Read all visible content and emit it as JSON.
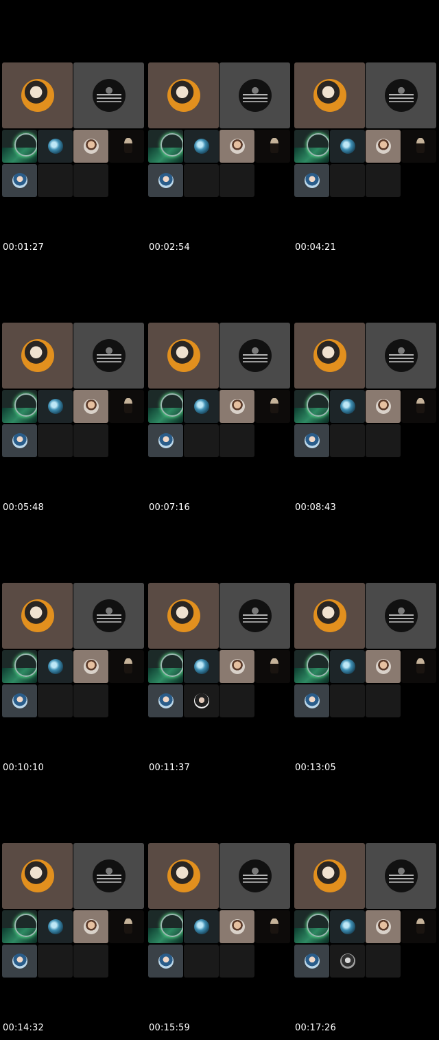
{
  "timestamps": [
    "00:01:27",
    "00:02:54",
    "00:04:21",
    "00:05:48",
    "00:07:16",
    "00:08:43",
    "00:10:10",
    "00:11:37",
    "00:13:05",
    "00:14:32",
    "00:15:59",
    "00:17:26"
  ],
  "colors": {
    "background": "#000000"
  },
  "frames": [
    {
      "r2_avatar": null
    },
    {
      "r2_avatar": null
    },
    {
      "r2_avatar": null
    },
    {
      "r2_avatar": null
    },
    {
      "r2_avatar": null
    },
    {
      "r2_avatar": null
    },
    {
      "r2_avatar": null
    },
    {
      "r2_avatar": "man-avatar-icon"
    },
    {
      "r2_avatar": null
    },
    {
      "r2_avatar": null
    },
    {
      "r2_avatar": null
    },
    {
      "r2_avatar": "grey-avatar-icon"
    }
  ]
}
